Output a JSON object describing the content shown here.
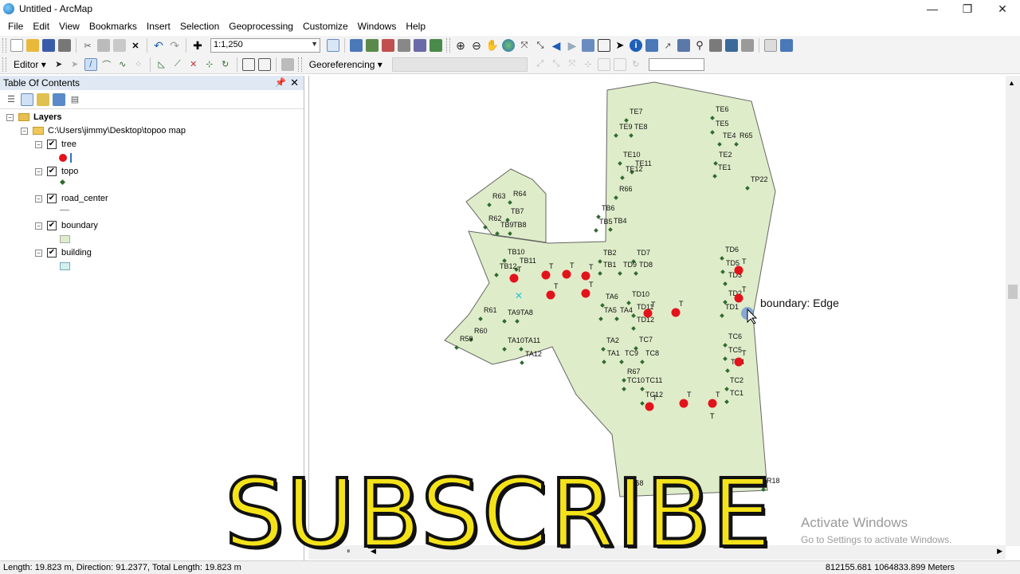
{
  "window": {
    "title": "Untitled - ArcMap"
  },
  "menu": [
    "File",
    "Edit",
    "View",
    "Bookmarks",
    "Insert",
    "Selection",
    "Geoprocessing",
    "Customize",
    "Windows",
    "Help"
  ],
  "toolbar": {
    "scale": "1:1,250",
    "editor_label": "Editor",
    "georef_label": "Georeferencing"
  },
  "toc": {
    "title": "Table Of Contents",
    "root": "Layers",
    "folder": "C:\\Users\\jimmy\\Desktop\\topoo map",
    "layers": [
      {
        "name": "tree",
        "checked": true,
        "symbol": "red-dot"
      },
      {
        "name": "topo",
        "checked": true,
        "symbol": "green-dot"
      },
      {
        "name": "road_center",
        "checked": true,
        "symbol": "line"
      },
      {
        "name": "boundary",
        "checked": true,
        "symbol": "green-box"
      },
      {
        "name": "building",
        "checked": true,
        "symbol": "teal-box"
      }
    ]
  },
  "map": {
    "topo_labels": [
      "TE7",
      "TE6",
      "TE9",
      "TE8",
      "TE5",
      "TE4",
      "R65",
      "TE10",
      "TE11",
      "TE2",
      "TE12",
      "TE1",
      "R64",
      "R63",
      "TP22",
      "R66",
      "TB7",
      "R62",
      "TB9",
      "TB8",
      "TB6",
      "TB5",
      "TB4",
      "TB10",
      "TB11",
      "TB12",
      "TB2",
      "TD7",
      "TD6",
      "TB1",
      "TD9",
      "TD8",
      "TD5",
      "TD3",
      "TA6",
      "TD10",
      "TD2",
      "TA5",
      "TA4",
      "TD11",
      "TD1",
      "R61",
      "TA9",
      "TA8",
      "TD12",
      "R60",
      "R59",
      "TA10",
      "TA11",
      "TA2",
      "TC7",
      "TC6",
      "TA12",
      "TA1",
      "TC9",
      "TC8",
      "TC5",
      "TC4",
      "R67",
      "TC10",
      "TC11",
      "TC12",
      "TC2",
      "TC1",
      "R68",
      "R18"
    ],
    "tree_label": "T",
    "tooltip": "boundary: Edge"
  },
  "overlay": {
    "subscribe": "SUBSCRIBE",
    "activate_title": "Activate Windows",
    "activate_sub": "Go to Settings to activate Windows."
  },
  "status": {
    "measure": "Length: 19.823 m, Direction: 91.2377, Total Length: 19.823 m",
    "coords": "812155.681  1064833.899 Meters"
  },
  "colors": {
    "boundary_fill": "#dfecc9",
    "tree": "#e3131b",
    "topo": "#2f6b2f",
    "subscribe": "#f5e31a"
  }
}
